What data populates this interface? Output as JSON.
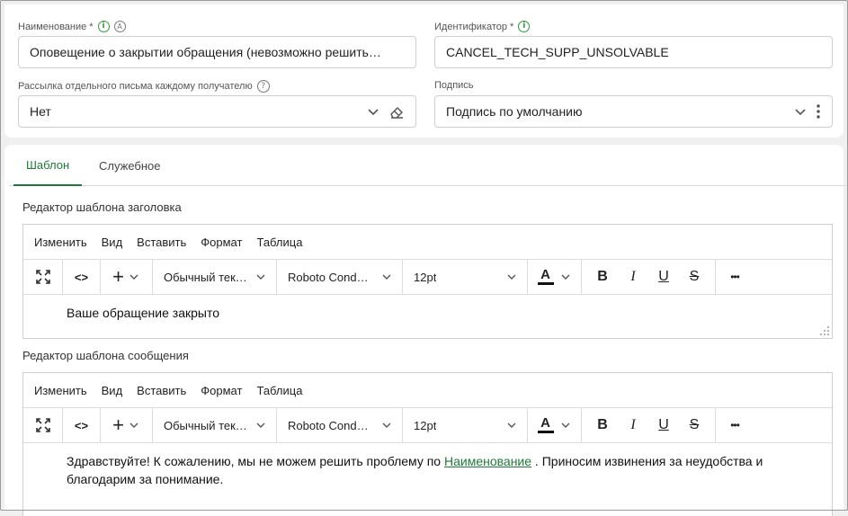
{
  "form": {
    "name_label": "Наименование *",
    "name_value": "Оповещение о закрытии обращения (невозможно решить…",
    "id_label": "Идентификатор *",
    "id_value": "CANCEL_TECH_SUPP_UNSOLVABLE",
    "mailing_label": "Рассылка отдельного письма каждому получателю",
    "mailing_value": "Нет",
    "signature_label": "Подпись",
    "signature_value": "Подпись по умолчанию",
    "info_glyph": "i",
    "auto_glyph": "A",
    "help_glyph": "?"
  },
  "tabs": [
    {
      "label": "Шаблон",
      "active": true
    },
    {
      "label": "Служебное",
      "active": false
    }
  ],
  "editors": [
    {
      "section_label": "Редактор шаблона заголовка",
      "menu": [
        "Изменить",
        "Вид",
        "Вставить",
        "Формат",
        "Таблица"
      ],
      "block_format": "Обычный тек…",
      "font_family": "Roboto Cond…",
      "font_size": "12pt",
      "content_text": "Ваше обращение закрыто"
    },
    {
      "section_label": "Редактор шаблона сообщения",
      "menu": [
        "Изменить",
        "Вид",
        "Вставить",
        "Формат",
        "Таблица"
      ],
      "block_format": "Обычный тек…",
      "font_family": "Roboto Cond…",
      "font_size": "12pt",
      "content_before": "Здравствуйте! К сожалению, мы не можем решить проблему по ",
      "content_link": "Наименование",
      "content_after": " . Приносим извинения за неудобства и благодарим за понимание."
    }
  ],
  "toolbar_glyphs": {
    "code": "<>",
    "add": "+",
    "text_color": "A",
    "bold": "B",
    "italic": "I",
    "underline": "U",
    "strike": "S",
    "more": "•••"
  },
  "colors": {
    "accent": "#1f7a3a",
    "info": "#2e9a3c",
    "border": "#cfcfcf",
    "background": "#f0f0f0"
  }
}
